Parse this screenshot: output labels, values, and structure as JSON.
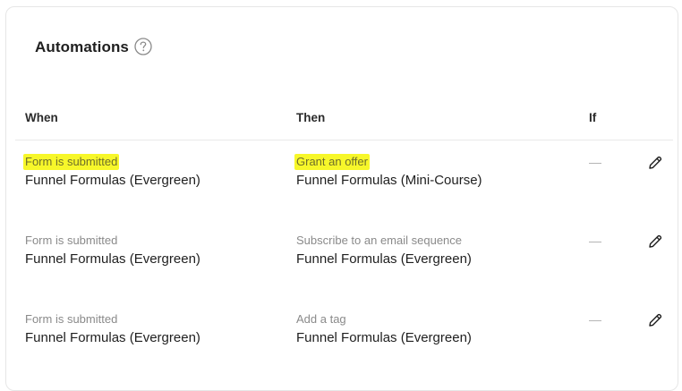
{
  "panel": {
    "title": "Automations",
    "help_icon": "question-circle-icon"
  },
  "table": {
    "columns": [
      "When",
      "Then",
      "If"
    ],
    "rows": [
      {
        "when_label": "Form is submitted",
        "when_value": "Funnel Formulas (Evergreen)",
        "then_label": "Grant an offer",
        "then_value": "Funnel Formulas (Mini-Course)",
        "if_value": "—",
        "highlighted": true
      },
      {
        "when_label": "Form is submitted",
        "when_value": "Funnel Formulas (Evergreen)",
        "then_label": "Subscribe to an email sequence",
        "then_value": "Funnel Formulas (Evergreen)",
        "if_value": "—",
        "highlighted": false
      },
      {
        "when_label": "Form is submitted",
        "when_value": "Funnel Formulas (Evergreen)",
        "then_label": "Add a tag",
        "then_value": "Funnel Formulas (Evergreen)",
        "if_value": "—",
        "highlighted": false
      }
    ]
  },
  "colors": {
    "highlight": "#f7f72a",
    "muted_text": "#8a8a8a",
    "border": "#e6e6e6"
  },
  "icons": {
    "edit": "pencil-icon"
  }
}
